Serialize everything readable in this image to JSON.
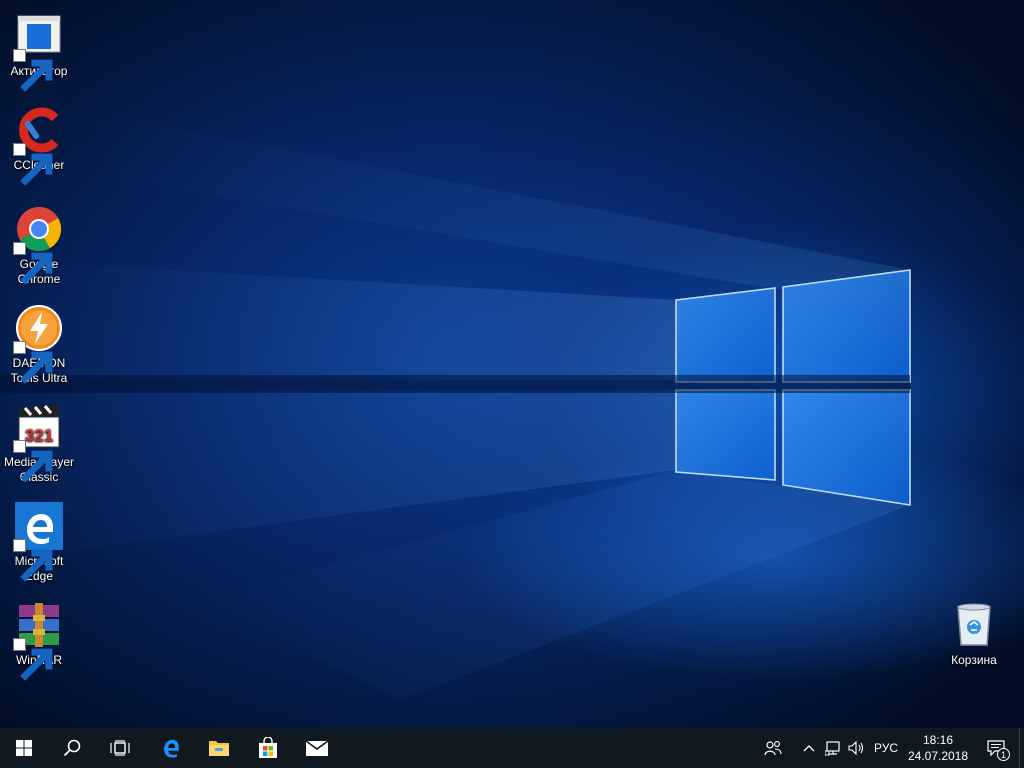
{
  "desktop": {
    "icons": [
      {
        "label": "Активатор",
        "icon": "activator-window-icon"
      },
      {
        "label": "CCleaner",
        "icon": "ccleaner-icon"
      },
      {
        "label": "Google Chrome",
        "icon": "chrome-icon"
      },
      {
        "label": "DAEMON Tools Ultra",
        "icon": "daemon-tools-icon"
      },
      {
        "label": "Media Player Classic",
        "icon": "media-player-classic-icon",
        "badge": "321"
      },
      {
        "label": "Microsoft Edge",
        "icon": "edge-icon"
      },
      {
        "label": "WinRAR",
        "icon": "winrar-icon"
      }
    ],
    "recycle_bin": {
      "label": "Корзина",
      "icon": "recycle-bin-icon"
    }
  },
  "taskbar": {
    "start": "windows-start-icon",
    "search": "search-icon",
    "task_view": "task-view-icon",
    "pinned": [
      "edge-icon",
      "file-explorer-icon",
      "store-icon",
      "mail-icon"
    ],
    "tray": {
      "people": "people-icon",
      "chevron": "chevron-up-icon",
      "network": "network-icon",
      "volume": "volume-icon",
      "language": "РУС",
      "time": "18:16",
      "date": "24.07.2018",
      "notifications": "action-center-icon",
      "notification_count": "1"
    }
  },
  "colors": {
    "taskbar": "#101820",
    "wallpaper_glow": "#2a8cff"
  }
}
